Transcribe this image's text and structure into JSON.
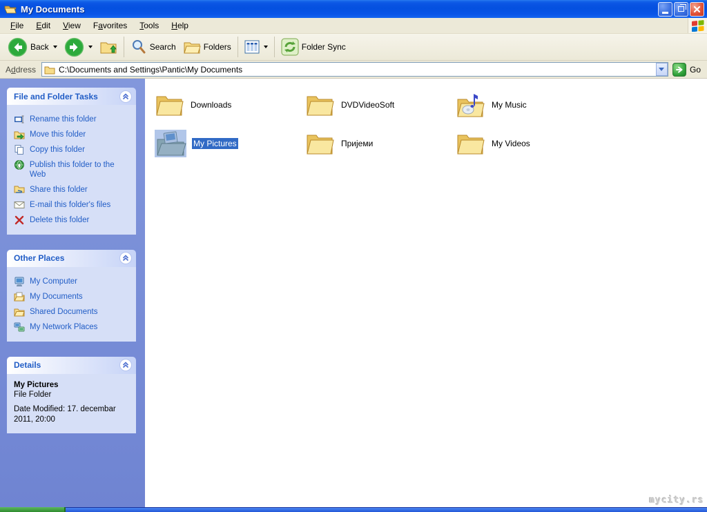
{
  "window": {
    "title": "My Documents"
  },
  "menu": {
    "items": [
      {
        "pre": "",
        "key": "F",
        "post": "ile"
      },
      {
        "pre": "",
        "key": "E",
        "post": "dit"
      },
      {
        "pre": "",
        "key": "V",
        "post": "iew"
      },
      {
        "pre": "F",
        "key": "a",
        "post": "vorites"
      },
      {
        "pre": "",
        "key": "T",
        "post": "ools"
      },
      {
        "pre": "",
        "key": "H",
        "post": "elp"
      }
    ]
  },
  "toolbar": {
    "back_label": "Back",
    "search_label": "Search",
    "folders_label": "Folders",
    "folder_sync_label": "Folder Sync"
  },
  "address": {
    "label_pre": "A",
    "label_key": "d",
    "label_post": "dress",
    "path": "C:\\Documents and Settings\\Pantic\\My Documents",
    "go_label": "Go"
  },
  "sidebar": {
    "tasks": {
      "title": "File and Folder Tasks",
      "items": [
        {
          "icon": "rename-icon",
          "label": "Rename this folder"
        },
        {
          "icon": "move-icon",
          "label": "Move this folder"
        },
        {
          "icon": "copy-icon",
          "label": "Copy this folder"
        },
        {
          "icon": "publish-web-icon",
          "label": "Publish this folder to the Web"
        },
        {
          "icon": "share-icon",
          "label": "Share this folder"
        },
        {
          "icon": "email-icon",
          "label": "E-mail this folder's files"
        },
        {
          "icon": "delete-icon",
          "label": "Delete this folder"
        }
      ]
    },
    "places": {
      "title": "Other Places",
      "items": [
        {
          "icon": "my-computer-icon",
          "label": "My Computer"
        },
        {
          "icon": "my-documents-icon",
          "label": "My Documents"
        },
        {
          "icon": "shared-documents-icon",
          "label": "Shared Documents"
        },
        {
          "icon": "my-network-places-icon",
          "label": "My Network Places"
        }
      ]
    },
    "details": {
      "title": "Details",
      "name": "My Pictures",
      "type": "File Folder",
      "modified": "Date Modified: 17. decembar 2011, 20:00"
    }
  },
  "folders": [
    {
      "name": "Downloads",
      "selected": false
    },
    {
      "name": "DVDVideoSoft",
      "selected": false
    },
    {
      "name": "My Music",
      "selected": false
    },
    {
      "name": "My Pictures",
      "selected": true
    },
    {
      "name": "Пријеми",
      "selected": false
    },
    {
      "name": "My Videos",
      "selected": false
    }
  ],
  "watermark": "mycity.rs",
  "colors": {
    "titlebar_blue": "#0450df",
    "selection_blue": "#316ac5",
    "sidebar_periwinkle": "#7b90d8",
    "panel_body": "#d6dff7",
    "task_link": "#215dc6",
    "menubar_tan": "#ece9d8",
    "taskbar_blue": "#2257d8",
    "start_green": "#2f8b2f"
  }
}
